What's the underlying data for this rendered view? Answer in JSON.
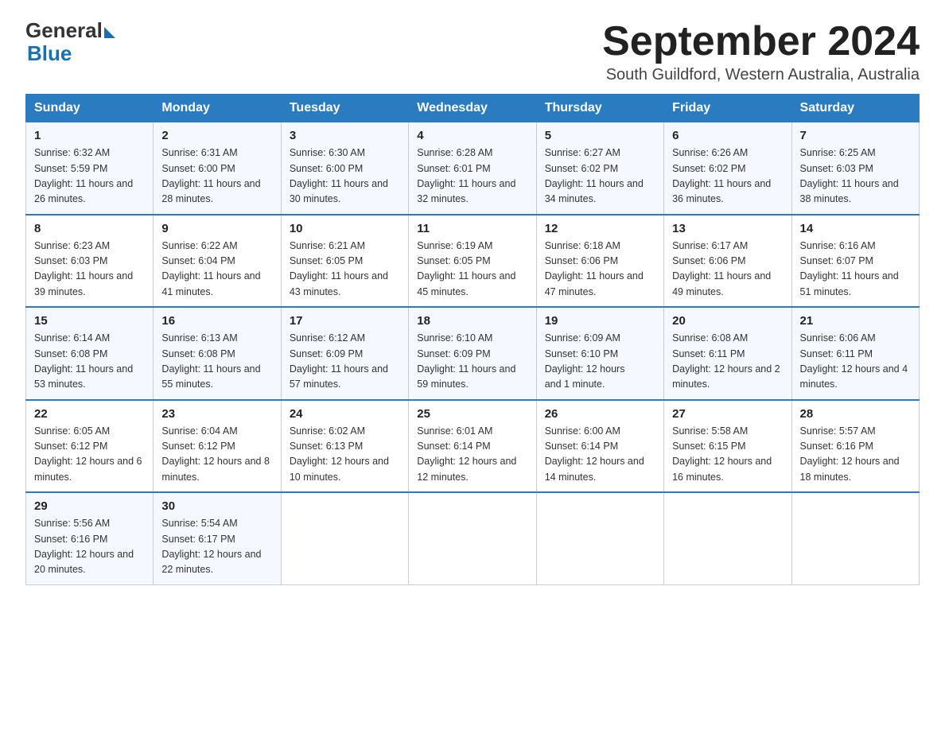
{
  "header": {
    "logo_general": "General",
    "logo_triangle": "",
    "logo_blue": "Blue",
    "title": "September 2024",
    "subtitle": "South Guildford, Western Australia, Australia"
  },
  "columns": [
    "Sunday",
    "Monday",
    "Tuesday",
    "Wednesday",
    "Thursday",
    "Friday",
    "Saturday"
  ],
  "weeks": [
    [
      {
        "day": "1",
        "sunrise": "6:32 AM",
        "sunset": "5:59 PM",
        "daylight": "11 hours and 26 minutes."
      },
      {
        "day": "2",
        "sunrise": "6:31 AM",
        "sunset": "6:00 PM",
        "daylight": "11 hours and 28 minutes."
      },
      {
        "day": "3",
        "sunrise": "6:30 AM",
        "sunset": "6:00 PM",
        "daylight": "11 hours and 30 minutes."
      },
      {
        "day": "4",
        "sunrise": "6:28 AM",
        "sunset": "6:01 PM",
        "daylight": "11 hours and 32 minutes."
      },
      {
        "day": "5",
        "sunrise": "6:27 AM",
        "sunset": "6:02 PM",
        "daylight": "11 hours and 34 minutes."
      },
      {
        "day": "6",
        "sunrise": "6:26 AM",
        "sunset": "6:02 PM",
        "daylight": "11 hours and 36 minutes."
      },
      {
        "day": "7",
        "sunrise": "6:25 AM",
        "sunset": "6:03 PM",
        "daylight": "11 hours and 38 minutes."
      }
    ],
    [
      {
        "day": "8",
        "sunrise": "6:23 AM",
        "sunset": "6:03 PM",
        "daylight": "11 hours and 39 minutes."
      },
      {
        "day": "9",
        "sunrise": "6:22 AM",
        "sunset": "6:04 PM",
        "daylight": "11 hours and 41 minutes."
      },
      {
        "day": "10",
        "sunrise": "6:21 AM",
        "sunset": "6:05 PM",
        "daylight": "11 hours and 43 minutes."
      },
      {
        "day": "11",
        "sunrise": "6:19 AM",
        "sunset": "6:05 PM",
        "daylight": "11 hours and 45 minutes."
      },
      {
        "day": "12",
        "sunrise": "6:18 AM",
        "sunset": "6:06 PM",
        "daylight": "11 hours and 47 minutes."
      },
      {
        "day": "13",
        "sunrise": "6:17 AM",
        "sunset": "6:06 PM",
        "daylight": "11 hours and 49 minutes."
      },
      {
        "day": "14",
        "sunrise": "6:16 AM",
        "sunset": "6:07 PM",
        "daylight": "11 hours and 51 minutes."
      }
    ],
    [
      {
        "day": "15",
        "sunrise": "6:14 AM",
        "sunset": "6:08 PM",
        "daylight": "11 hours and 53 minutes."
      },
      {
        "day": "16",
        "sunrise": "6:13 AM",
        "sunset": "6:08 PM",
        "daylight": "11 hours and 55 minutes."
      },
      {
        "day": "17",
        "sunrise": "6:12 AM",
        "sunset": "6:09 PM",
        "daylight": "11 hours and 57 minutes."
      },
      {
        "day": "18",
        "sunrise": "6:10 AM",
        "sunset": "6:09 PM",
        "daylight": "11 hours and 59 minutes."
      },
      {
        "day": "19",
        "sunrise": "6:09 AM",
        "sunset": "6:10 PM",
        "daylight": "12 hours and 1 minute."
      },
      {
        "day": "20",
        "sunrise": "6:08 AM",
        "sunset": "6:11 PM",
        "daylight": "12 hours and 2 minutes."
      },
      {
        "day": "21",
        "sunrise": "6:06 AM",
        "sunset": "6:11 PM",
        "daylight": "12 hours and 4 minutes."
      }
    ],
    [
      {
        "day": "22",
        "sunrise": "6:05 AM",
        "sunset": "6:12 PM",
        "daylight": "12 hours and 6 minutes."
      },
      {
        "day": "23",
        "sunrise": "6:04 AM",
        "sunset": "6:12 PM",
        "daylight": "12 hours and 8 minutes."
      },
      {
        "day": "24",
        "sunrise": "6:02 AM",
        "sunset": "6:13 PM",
        "daylight": "12 hours and 10 minutes."
      },
      {
        "day": "25",
        "sunrise": "6:01 AM",
        "sunset": "6:14 PM",
        "daylight": "12 hours and 12 minutes."
      },
      {
        "day": "26",
        "sunrise": "6:00 AM",
        "sunset": "6:14 PM",
        "daylight": "12 hours and 14 minutes."
      },
      {
        "day": "27",
        "sunrise": "5:58 AM",
        "sunset": "6:15 PM",
        "daylight": "12 hours and 16 minutes."
      },
      {
        "day": "28",
        "sunrise": "5:57 AM",
        "sunset": "6:16 PM",
        "daylight": "12 hours and 18 minutes."
      }
    ],
    [
      {
        "day": "29",
        "sunrise": "5:56 AM",
        "sunset": "6:16 PM",
        "daylight": "12 hours and 20 minutes."
      },
      {
        "day": "30",
        "sunrise": "5:54 AM",
        "sunset": "6:17 PM",
        "daylight": "12 hours and 22 minutes."
      },
      null,
      null,
      null,
      null,
      null
    ]
  ],
  "labels": {
    "sunrise": "Sunrise:",
    "sunset": "Sunset:",
    "daylight": "Daylight:"
  }
}
